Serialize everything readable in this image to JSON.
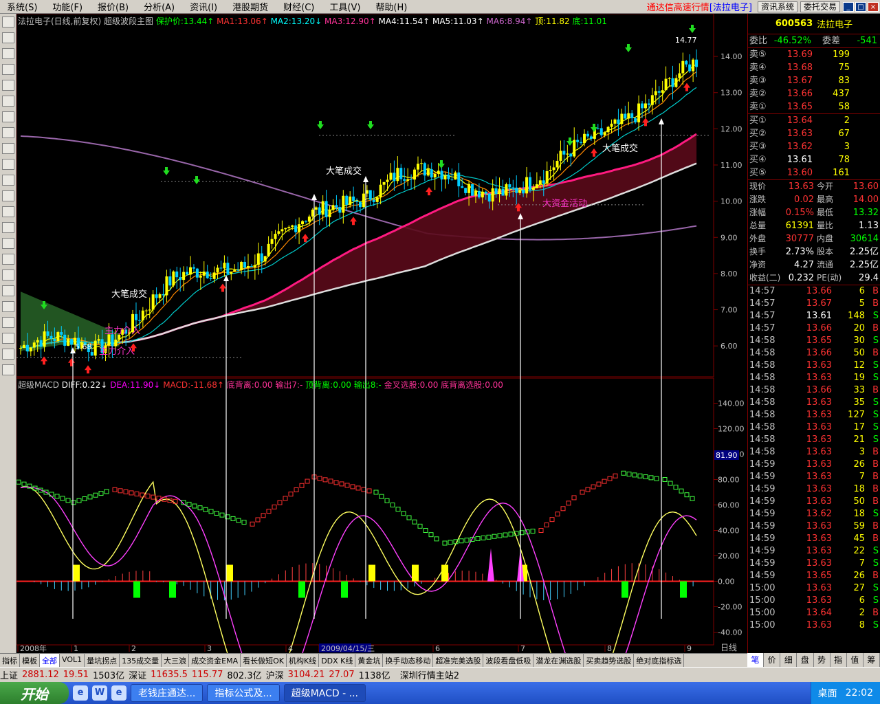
{
  "menu": [
    "系统(S)",
    "功能(F)",
    "报价(B)",
    "分析(A)",
    "资讯(I)",
    "港股期货",
    "财经(C)",
    "工具(V)",
    "帮助(H)"
  ],
  "app_title_prefix": "通达信高速行情",
  "app_title_stock": "[法拉电子]",
  "top_buttons": [
    "资讯系统",
    "委托交易"
  ],
  "window_buttons": [
    "_",
    "□",
    "×"
  ],
  "main_header": {
    "name": "法拉电子(日线,前复权) 超级波段主图",
    "items": [
      {
        "t": "保护价:13.44↑",
        "c": "#00ff00"
      },
      {
        "t": "MA1:13.06↑",
        "c": "#ff3333"
      },
      {
        "t": "MA2:13.20↓",
        "c": "#00ffff"
      },
      {
        "t": "MA3:12.90↑",
        "c": "#ff3399"
      },
      {
        "t": "MA4:11.54↑",
        "c": "#ffffff"
      },
      {
        "t": "MA5:11.03↑",
        "c": "#ffffff"
      },
      {
        "t": "MA6:8.94↑",
        "c": "#cc66cc"
      },
      {
        "t": "顶:11.82",
        "c": "#ffff00"
      },
      {
        "t": "底:11.01",
        "c": "#00ff00"
      }
    ]
  },
  "sub_header": {
    "name": "超级MACD",
    "items": [
      {
        "t": "DIFF:0.22↓",
        "c": "#ffffff"
      },
      {
        "t": "DEA:11.90↓",
        "c": "#ff00ff"
      },
      {
        "t": "MACD:-11.68↑",
        "c": "#ff3333"
      },
      {
        "t": "底背离:0.00",
        "c": "#ff3399"
      },
      {
        "t": "输出7:-",
        "c": "#ff3399"
      },
      {
        "t": "顶背离:0.00",
        "c": "#00ff00"
      },
      {
        "t": "输出8:-",
        "c": "#00ff00"
      },
      {
        "t": "金叉选股:0.00",
        "c": "#ff3399"
      },
      {
        "t": "底背离选股:0.00",
        "c": "#ff3399"
      }
    ]
  },
  "price_axis": [
    "14.00",
    "13.00",
    "12.00",
    "11.00",
    "10.00",
    "9.00",
    "8.00",
    "7.00",
    "6.00"
  ],
  "macd_axis": [
    "140.00",
    "120.00",
    "100.00",
    "80.00",
    "60.00",
    "40.00",
    "20.00",
    "0.00",
    "-20.00",
    "-40.00"
  ],
  "macd_current_label": "81.90",
  "annotations": {
    "high": "14.77",
    "low": "5.68",
    "a1": "大笔成交",
    "a2": "大笔成交",
    "a3": "大笔成交",
    "a4": "大资金活动",
    "a5": "主力介入",
    "a6": "主力介入"
  },
  "time_axis": [
    "2008年",
    "1",
    "2",
    "3",
    "4",
    "2009/04/15/三",
    "6",
    "7",
    "8",
    "9"
  ],
  "time_axis_right": "日线",
  "bottom_tabs": [
    "指标",
    "模板",
    "全部",
    "VOL1",
    "量坑拐点",
    "135成交量",
    "大三浪",
    "成交资金EMA",
    "看长做短OK",
    "机构K线",
    "DDX K线",
    "黄金坑",
    "换手动态移动",
    "超准完美选股",
    "波段看盘低吸",
    "潜龙在渊选股",
    "买卖趋势选股",
    "绝对底指标选"
  ],
  "bottom_active": "全部",
  "quote": {
    "code": "600563",
    "name": "法拉电子",
    "weibi_label": "委比",
    "weibi": "-46.52%",
    "weicha_label": "委差",
    "weicha": "-541",
    "sells": [
      {
        "l": "卖⑤",
        "p": "13.69",
        "v": "199"
      },
      {
        "l": "卖④",
        "p": "13.68",
        "v": "75"
      },
      {
        "l": "卖③",
        "p": "13.67",
        "v": "83"
      },
      {
        "l": "卖②",
        "p": "13.66",
        "v": "437"
      },
      {
        "l": "卖①",
        "p": "13.65",
        "v": "58"
      }
    ],
    "buys": [
      {
        "l": "买①",
        "p": "13.64",
        "v": "2"
      },
      {
        "l": "买②",
        "p": "13.63",
        "v": "67"
      },
      {
        "l": "买③",
        "p": "13.62",
        "v": "3"
      },
      {
        "l": "买④",
        "p": "13.61",
        "v": "78"
      },
      {
        "l": "买⑤",
        "p": "13.60",
        "v": "161"
      }
    ],
    "stats": [
      {
        "a": "现价",
        "b": "13.63",
        "c": "今开",
        "d": "13.60",
        "bc": "#ff3333",
        "dc": "#ff3333"
      },
      {
        "a": "涨跌",
        "b": "0.02",
        "c": "最高",
        "d": "14.00",
        "bc": "#ff3333",
        "dc": "#ff3333"
      },
      {
        "a": "涨幅",
        "b": "0.15%",
        "c": "最低",
        "d": "13.32",
        "bc": "#ff3333",
        "dc": "#00ff00"
      },
      {
        "a": "总量",
        "b": "61391",
        "c": "量比",
        "d": "1.13",
        "bc": "#ffff00",
        "dc": "#ffffff"
      },
      {
        "a": "外盘",
        "b": "30777",
        "c": "内盘",
        "d": "30614",
        "bc": "#ff3333",
        "dc": "#00ff00"
      },
      {
        "a": "换手",
        "b": "2.73%",
        "c": "股本",
        "d": "2.25亿",
        "bc": "#ffffff",
        "dc": "#ffffff"
      },
      {
        "a": "净资",
        "b": "4.27",
        "c": "流通",
        "d": "2.25亿",
        "bc": "#ffffff",
        "dc": "#ffffff"
      },
      {
        "a": "收益(二)",
        "b": "0.232",
        "c": "PE(动)",
        "d": "29.4",
        "bc": "#ffffff",
        "dc": "#ffffff"
      }
    ],
    "ticks": [
      {
        "t": "14:57",
        "p": "13.66",
        "v": "6",
        "s": "B",
        "pc": "#ff3333"
      },
      {
        "t": "14:57",
        "p": "13.67",
        "v": "5",
        "s": "B",
        "pc": "#ff3333"
      },
      {
        "t": "14:57",
        "p": "13.61",
        "v": "148",
        "s": "S",
        "pc": "#ffffff"
      },
      {
        "t": "14:57",
        "p": "13.66",
        "v": "20",
        "s": "B",
        "pc": "#ff3333"
      },
      {
        "t": "14:58",
        "p": "13.65",
        "v": "30",
        "s": "S",
        "pc": "#ff3333"
      },
      {
        "t": "14:58",
        "p": "13.66",
        "v": "50",
        "s": "B",
        "pc": "#ff3333"
      },
      {
        "t": "14:58",
        "p": "13.63",
        "v": "12",
        "s": "S",
        "pc": "#ff3333"
      },
      {
        "t": "14:58",
        "p": "13.63",
        "v": "19",
        "s": "S",
        "pc": "#ff3333"
      },
      {
        "t": "14:58",
        "p": "13.66",
        "v": "33",
        "s": "B",
        "pc": "#ff3333"
      },
      {
        "t": "14:58",
        "p": "13.63",
        "v": "35",
        "s": "S",
        "pc": "#ff3333"
      },
      {
        "t": "14:58",
        "p": "13.63",
        "v": "127",
        "s": "S",
        "pc": "#ff3333"
      },
      {
        "t": "14:58",
        "p": "13.63",
        "v": "17",
        "s": "S",
        "pc": "#ff3333"
      },
      {
        "t": "14:58",
        "p": "13.63",
        "v": "21",
        "s": "S",
        "pc": "#ff3333"
      },
      {
        "t": "14:58",
        "p": "13.63",
        "v": "3",
        "s": "B",
        "pc": "#ff3333"
      },
      {
        "t": "14:59",
        "p": "13.63",
        "v": "26",
        "s": "B",
        "pc": "#ff3333"
      },
      {
        "t": "14:59",
        "p": "13.63",
        "v": "7",
        "s": "B",
        "pc": "#ff3333"
      },
      {
        "t": "14:59",
        "p": "13.63",
        "v": "18",
        "s": "B",
        "pc": "#ff3333"
      },
      {
        "t": "14:59",
        "p": "13.63",
        "v": "50",
        "s": "B",
        "pc": "#ff3333"
      },
      {
        "t": "14:59",
        "p": "13.62",
        "v": "18",
        "s": "S",
        "pc": "#ff3333"
      },
      {
        "t": "14:59",
        "p": "13.63",
        "v": "59",
        "s": "B",
        "pc": "#ff3333"
      },
      {
        "t": "14:59",
        "p": "13.63",
        "v": "45",
        "s": "B",
        "pc": "#ff3333"
      },
      {
        "t": "14:59",
        "p": "13.63",
        "v": "22",
        "s": "S",
        "pc": "#ff3333"
      },
      {
        "t": "14:59",
        "p": "13.63",
        "v": "7",
        "s": "S",
        "pc": "#ff3333"
      },
      {
        "t": "14:59",
        "p": "13.65",
        "v": "26",
        "s": "B",
        "pc": "#ff3333"
      },
      {
        "t": "15:00",
        "p": "13.63",
        "v": "27",
        "s": "S",
        "pc": "#ff3333"
      },
      {
        "t": "15:00",
        "p": "13.63",
        "v": "6",
        "s": "S",
        "pc": "#ff3333"
      },
      {
        "t": "15:00",
        "p": "13.64",
        "v": "2",
        "s": "B",
        "pc": "#ff3333"
      },
      {
        "t": "15:00",
        "p": "13.63",
        "v": "8",
        "s": "S",
        "pc": "#ff3333"
      }
    ]
  },
  "right_tabs": [
    "笔",
    "价",
    "细",
    "盘",
    "势",
    "指",
    "值",
    "筹"
  ],
  "status": [
    {
      "t": "上证",
      "c": "#000"
    },
    {
      "t": "2881.12",
      "c": "#c00"
    },
    {
      "t": "19.51",
      "c": "#c00"
    },
    {
      "t": "1503亿",
      "c": "#000"
    },
    {
      "t": "深证",
      "c": "#000"
    },
    {
      "t": "11635.5",
      "c": "#c00"
    },
    {
      "t": "115.77",
      "c": "#c00"
    },
    {
      "t": "802.3亿",
      "c": "#000"
    },
    {
      "t": "沪深",
      "c": "#000"
    },
    {
      "t": "3104.21",
      "c": "#c00"
    },
    {
      "t": "27.07",
      "c": "#c00"
    },
    {
      "t": "1138亿",
      "c": "#000"
    }
  ],
  "status_server": "深圳行情主站2",
  "taskbar": {
    "start": "开始",
    "windows": [
      "老钱庄通达...",
      "指标公式及...",
      "超级MACD - ..."
    ],
    "desktop": "桌面",
    "clock": "22:02"
  },
  "chart_data": [
    {
      "type": "candlestick",
      "title": "法拉电子(日线,前复权) 超级波段主图",
      "ylim": [
        5.3,
        14.8
      ],
      "x": [
        "2008-12",
        "2009-01",
        "2009-02",
        "2009-03",
        "2009-04",
        "2009-05",
        "2009-06",
        "2009-07",
        "2009-08",
        "2009-09"
      ],
      "close": [
        5.95,
        6.05,
        7.6,
        8.45,
        9.55,
        10.85,
        10.4,
        10.6,
        12.4,
        13.63
      ],
      "high_label": 14.77,
      "low_label": 5.68
    },
    {
      "type": "line",
      "title": "超级MACD",
      "ylim": [
        -50,
        150
      ],
      "series": [
        {
          "name": "DIFF",
          "final": 0.22
        },
        {
          "name": "DEA",
          "final": 11.9
        },
        {
          "name": "MACD",
          "final": -11.68
        }
      ]
    }
  ]
}
